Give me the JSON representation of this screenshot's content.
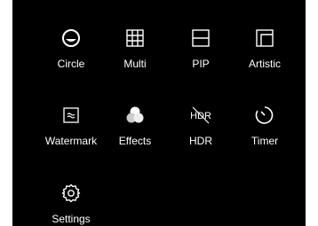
{
  "background_color": "#000000",
  "foreground_color": "#ffffff",
  "modes": [
    {
      "id": "circle",
      "label": "Circle",
      "icon": "circle-mode-icon"
    },
    {
      "id": "multi",
      "label": "Multi",
      "icon": "grid-mode-icon"
    },
    {
      "id": "pip",
      "label": "PIP",
      "icon": "pip-mode-icon"
    },
    {
      "id": "artistic",
      "label": "Artistic",
      "icon": "artistic-mode-icon"
    },
    {
      "id": "watermark",
      "label": "Watermark",
      "icon": "watermark-icon"
    },
    {
      "id": "effects",
      "label": "Effects",
      "icon": "effects-icon"
    },
    {
      "id": "hdr",
      "label": "HDR",
      "icon": "hdr-off-icon"
    },
    {
      "id": "timer",
      "label": "Timer",
      "icon": "timer-icon"
    },
    {
      "id": "settings",
      "label": "Settings",
      "icon": "settings-gear-icon"
    }
  ]
}
